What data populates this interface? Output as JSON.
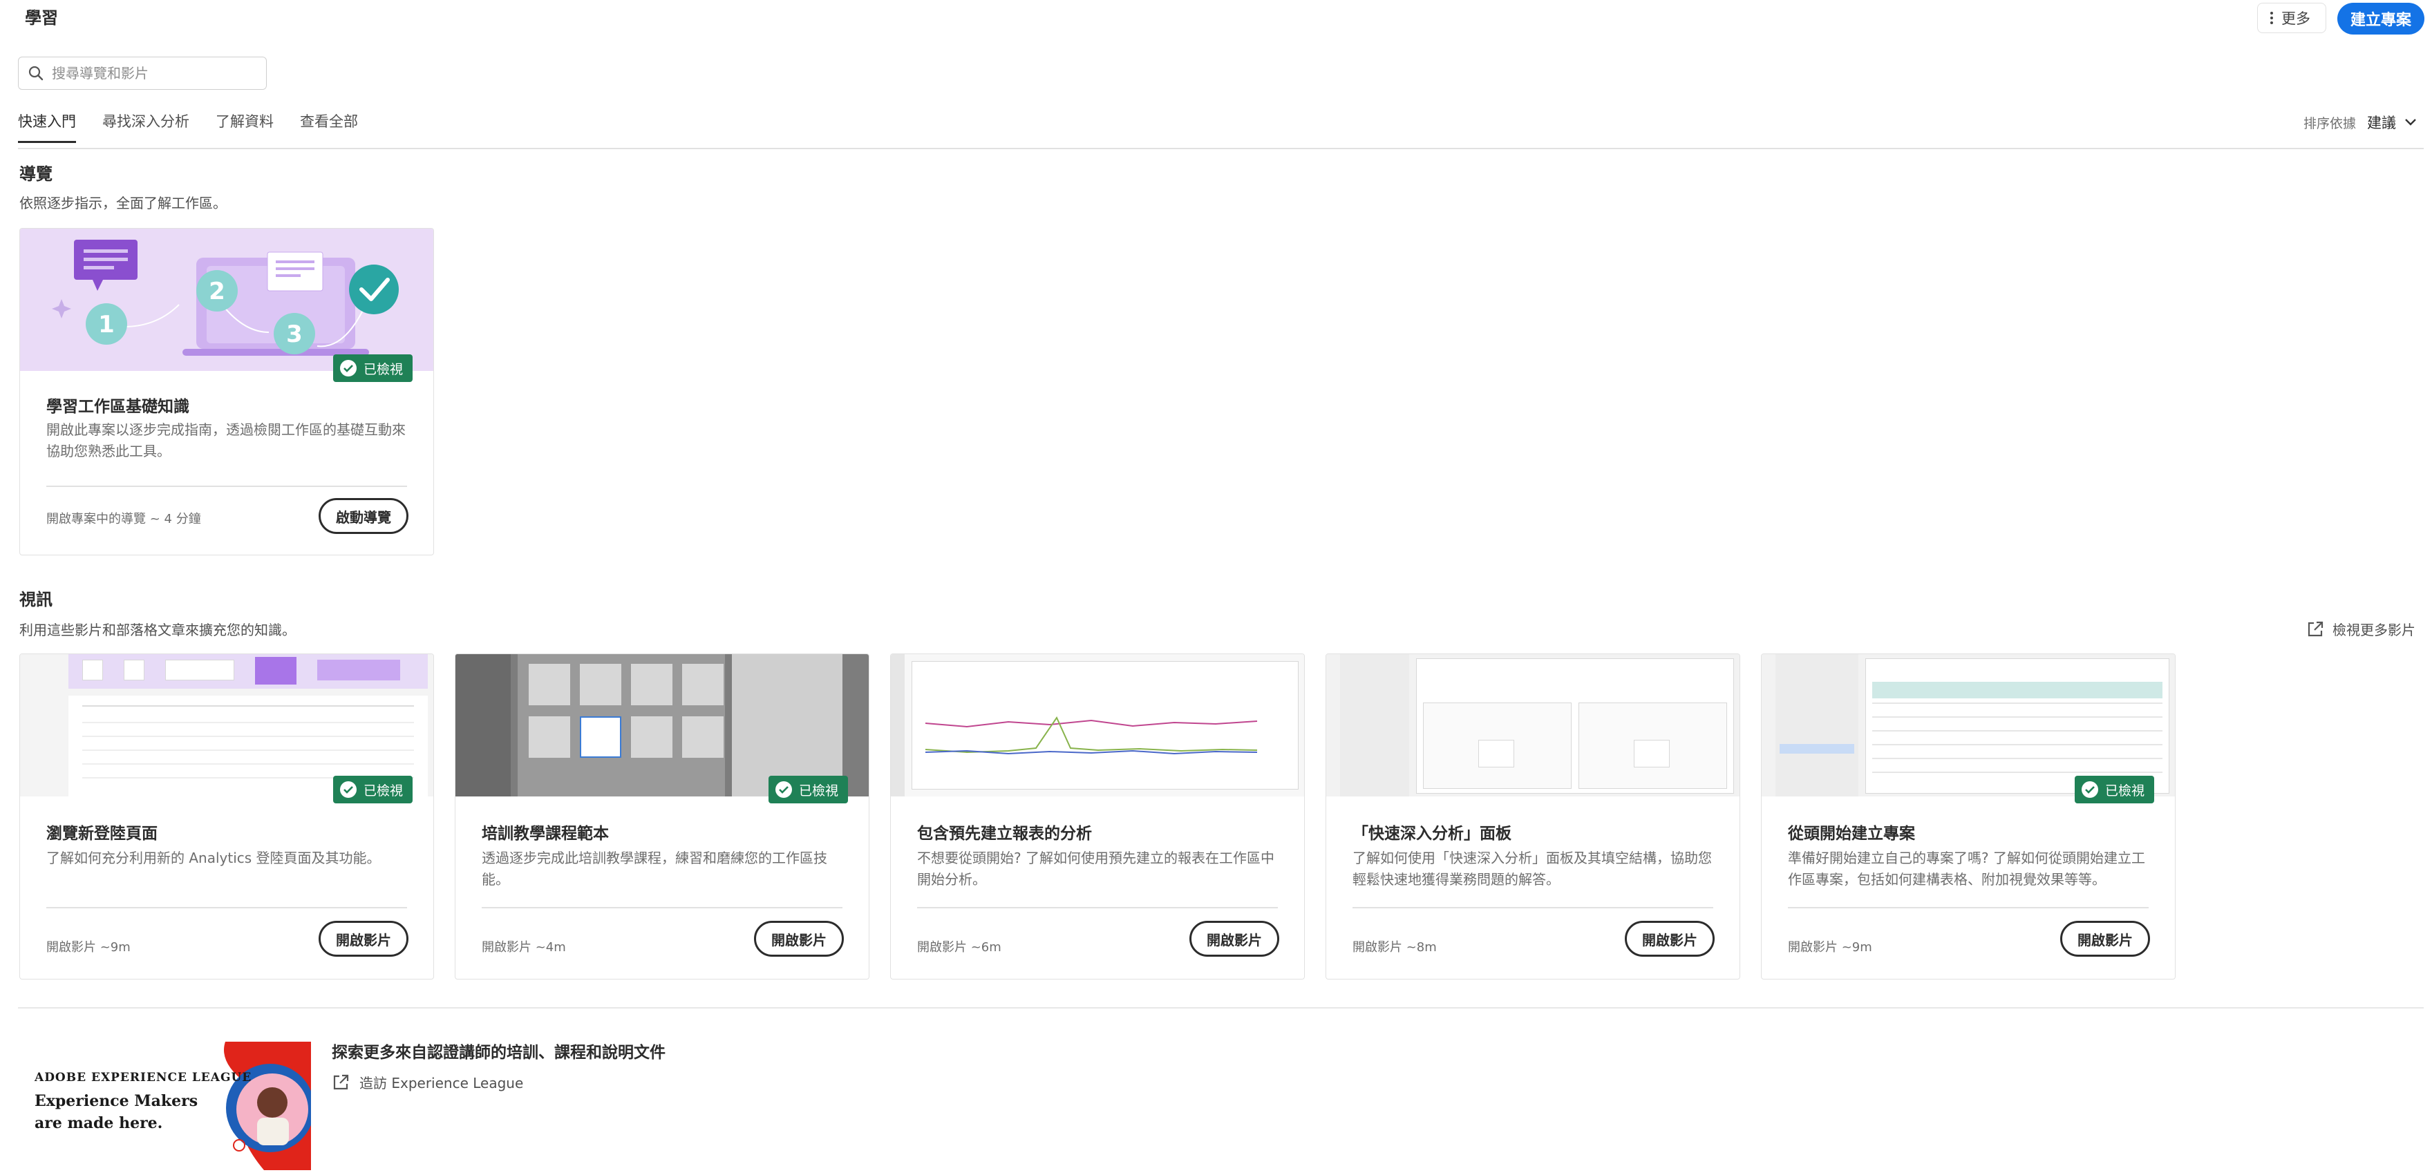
{
  "header": {
    "title": "學習",
    "more_label": "更多",
    "create_label": "建立專案"
  },
  "search": {
    "placeholder": "搜尋導覽和影片"
  },
  "tabs": [
    {
      "label": "快速入門",
      "active": true
    },
    {
      "label": "尋找深入分析",
      "active": false
    },
    {
      "label": "了解資料",
      "active": false
    },
    {
      "label": "查看全部",
      "active": false
    }
  ],
  "sort": {
    "label": "排序依據",
    "value": "建議"
  },
  "tours": {
    "title": "導覽",
    "description": "依照逐步指示，全面了解工作區。",
    "cards": [
      {
        "badge": "已檢視",
        "title": "學習工作區基礎知識",
        "description": "開啟此專案以逐步完成指南，透過檢閱工作區的基礎互動來協助您熟悉此工具。",
        "meta": "開啟專案中的導覽 ~ 4 分鐘",
        "button": "啟動導覽",
        "thumb_numbers": [
          "1",
          "2",
          "3"
        ]
      }
    ]
  },
  "videos": {
    "title": "視訊",
    "description": "利用這些影片和部落格文章來擴充您的知識。",
    "view_more": "檢視更多影片",
    "cards": [
      {
        "badge": "已檢視",
        "title": "瀏覽新登陸頁面",
        "description": "了解如何充分利用新的 Analytics 登陸頁面及其功能。",
        "meta": "開啟影片 ~9m",
        "button": "開啟影片"
      },
      {
        "badge": "已檢視",
        "title": "培訓教學課程範本",
        "description": "透過逐步完成此培訓教學課程，練習和磨練您的工作區技能。",
        "meta": "開啟影片 ~4m",
        "button": "開啟影片"
      },
      {
        "badge": "",
        "title": "包含預先建立報表的分析",
        "description": "不想要從頭開始? 了解如何使用預先建立的報表在工作區中開始分析。",
        "meta": "開啟影片 ~6m",
        "button": "開啟影片"
      },
      {
        "badge": "",
        "title": "「快速深入分析」面板",
        "description": "了解如何使用「快速深入分析」面板及其填空結構，協助您輕鬆快速地獲得業務問題的解答。",
        "meta": "開啟影片 ~8m",
        "button": "開啟影片"
      },
      {
        "badge": "已檢視",
        "title": "從頭開始建立專案",
        "description": "準備好開始建立自己的專案了嗎? 了解如何從頭開始建立工作區專案，包括如何建構表格、附加視覺效果等等。",
        "meta": "開啟影片 ~9m",
        "button": "開啟影片"
      }
    ]
  },
  "explore": {
    "banner_brand": "ADOBE EXPERIENCE LEAGUE",
    "banner_tagline": "Experience Makers are made here.",
    "title": "探索更多來自認證講師的培訓、課程和說明文件",
    "link": "造訪 Experience League"
  },
  "colors": {
    "primary": "#1473e6",
    "viewed_badge": "#1f8156",
    "tour_thumb_bg": "#eadbf7",
    "tour_accent": "#8a4fcf",
    "teal": "#2aa6a3"
  }
}
